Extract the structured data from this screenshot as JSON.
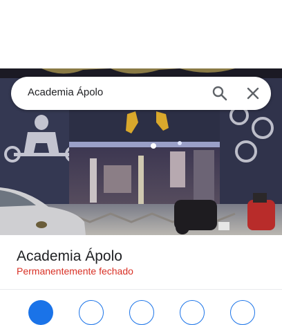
{
  "search": {
    "query": "Academia Ápolo",
    "search_icon": "search-icon",
    "close_icon": "close-icon"
  },
  "place": {
    "name": "Academia Ápolo",
    "status": "Permanentemente fechado",
    "status_color": "#d93025"
  },
  "photo": {
    "sign_text": "APOLO"
  },
  "colors": {
    "accent": "#1a73e8",
    "status": "#d93025"
  }
}
